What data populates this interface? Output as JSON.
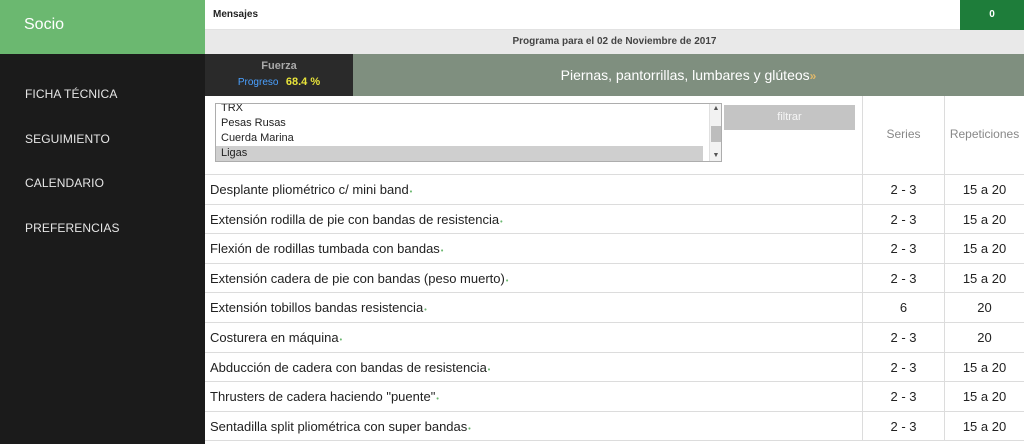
{
  "sidebar": {
    "brand": "Socio",
    "items": [
      {
        "label": "FICHA TÉCNICA"
      },
      {
        "label": "SEGUIMIENTO"
      },
      {
        "label": "CALENDARIO"
      },
      {
        "label": "PREFERENCIAS"
      }
    ]
  },
  "topbar": {
    "messages_label": "Mensajes",
    "badge_count": "0"
  },
  "program": {
    "title": "Programa para el 02 de Noviembre de 2017"
  },
  "focus": {
    "label": "Fuerza",
    "progress_label": "Progreso",
    "progress_value": "68.4 %"
  },
  "muscles": {
    "title": "Piernas, pantorrillas, lumbares y glúteos",
    "arrow": "»"
  },
  "filter": {
    "options": [
      "TRX",
      "Pesas Rusas",
      "Cuerda Marina",
      "Ligas"
    ],
    "selected": "Ligas",
    "button_label": "filtrar"
  },
  "table": {
    "headers": {
      "series": "Series",
      "reps": "Repeticiones"
    },
    "rows": [
      {
        "name": "Desplante pliométrico c/ mini band",
        "series": "2 - 3",
        "reps": "15 a 20"
      },
      {
        "name": "Extensión rodilla de pie con bandas de resistencia",
        "series": "2 - 3",
        "reps": "15 a 20"
      },
      {
        "name": "Flexión de rodillas tumbada con bandas",
        "series": "2 - 3",
        "reps": "15 a 20"
      },
      {
        "name": "Extensión cadera de pie con bandas (peso muerto)",
        "series": "2 - 3",
        "reps": "15 a 20"
      },
      {
        "name": "Extensión tobillos bandas resistencia",
        "series": "6",
        "reps": "20"
      },
      {
        "name": "Costurera en máquina",
        "series": "2 - 3",
        "reps": "20"
      },
      {
        "name": "Abducción de cadera con bandas de resistencia",
        "series": "2 - 3",
        "reps": "15 a 20"
      },
      {
        "name": "Thrusters de cadera haciendo \"puente\"",
        "series": "2 - 3",
        "reps": "15 a 20"
      },
      {
        "name": "Sentadilla split pliométrica con super bandas",
        "series": "2 - 3",
        "reps": "15 a 20"
      }
    ],
    "row_marker": "•"
  },
  "colors": {
    "sidebar_bg": "#1b1b1b",
    "brand_green": "#6bb870",
    "badge_green": "#1e7d3a",
    "banner_gray_green": "#7f8f7f",
    "progress_value_yellow": "#e8e43a",
    "progress_label_blue": "#4aa0ff"
  }
}
